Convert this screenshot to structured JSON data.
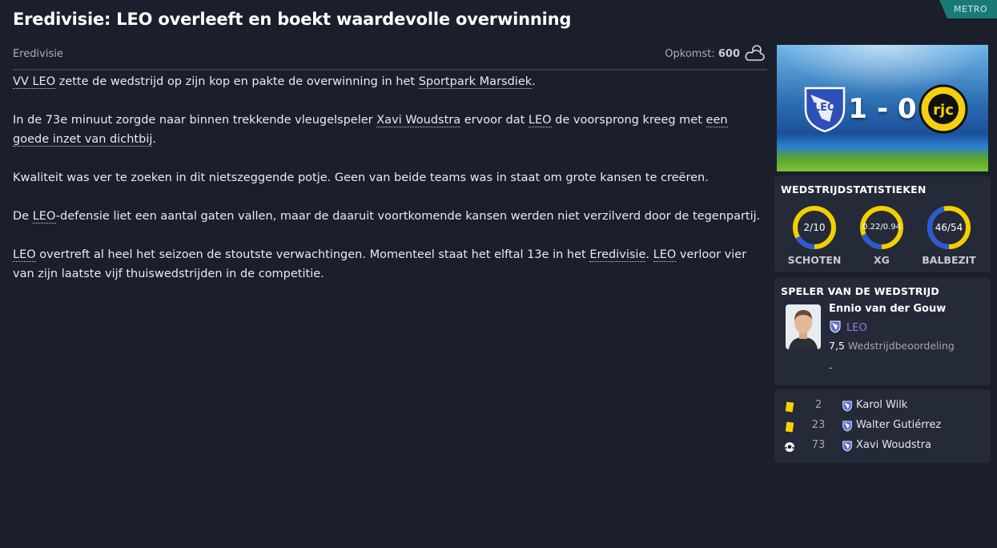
{
  "badge": "METRO",
  "headline": "Eredivisie: LEO overleeft en boekt waardevolle overwinning",
  "meta": {
    "competition": "Eredivisie",
    "attendance_label": "Opkomst:",
    "attendance_value": "600",
    "weather_icon": "partly-cloudy-icon"
  },
  "article": {
    "p1": {
      "club": "VV LEO",
      "a": " zette de wedstrijd op zijn kop en pakte de overwinning in het ",
      "stadium": "Sportpark Marsdiek",
      "b": "."
    },
    "p2": {
      "a": "In de 73e minuut zorgde naar binnen trekkende vleugelspeler ",
      "player": "Xavi Woudstra",
      "b": " ervoor dat ",
      "club": "LEO",
      "c": " de voorsprong kreeg met ",
      "goal": "een goede inzet van dichtbij",
      "d": "."
    },
    "p3": "Kwaliteit was ver te zoeken in dit nietszeggende potje. Geen van beide teams was in staat om grote kansen te creëren.",
    "p4": {
      "a": "De ",
      "club": "LEO",
      "b": "-defensie liet een aantal gaten vallen, maar de daaruit voortkomende kansen werden niet verzilverd door de tegenpartij."
    },
    "p5": {
      "club": "LEO",
      "a": " overtreft al heel het seizoen de stoutste verwachtingen. Momenteel staat het elftal 13e in het ",
      "competition": "Eredivisie",
      "b": ". ",
      "club2": "LEO",
      "c": " verloor vier van zijn laatste vijf thuiswedstrijden in de competitie."
    }
  },
  "score": {
    "home_goals": "1",
    "separator": "-",
    "away_goals": "0",
    "home_crest": "leo-crest-icon",
    "away_crest": "roda-jc-crest-icon"
  },
  "stats": {
    "title": "WEDSTRIJDSTATISTIEKEN",
    "home_color": "#2a5bd7",
    "away_color": "#f2d000",
    "items": [
      {
        "label": "SCHOTEN",
        "text": "2/10",
        "home": 2,
        "away": 10
      },
      {
        "label": "XG",
        "text": "0.22/0.94",
        "home": 0.22,
        "away": 0.94
      },
      {
        "label": "BALBEZIT",
        "text": "46/54",
        "home": 46,
        "away": 54
      }
    ]
  },
  "motm": {
    "title": "SPELER VAN DE WEDSTRIJD",
    "name": "Ennio van der Gouw",
    "club": "LEO",
    "rating": "7,5",
    "rating_label": "Wedstrijdbeoordeling",
    "extra": "-"
  },
  "events": [
    {
      "type": "yellow-card-icon",
      "minute": "2",
      "player": "Karol Wilk"
    },
    {
      "type": "yellow-card-icon",
      "minute": "23",
      "player": "Walter Gutiérrez"
    },
    {
      "type": "goal-ball-icon",
      "minute": "73",
      "player": "Xavi Woudstra"
    }
  ]
}
